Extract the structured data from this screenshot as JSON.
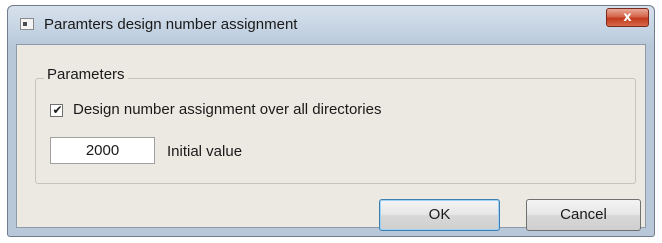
{
  "window": {
    "title": "Paramters design number assignment",
    "close_label": "x"
  },
  "parameters": {
    "group_label": "Parameters",
    "checkbox": {
      "label": "Design number assignment over all directories",
      "checked": true,
      "mark": "✔"
    },
    "initial_value": {
      "value": "2000",
      "label": "Initial value"
    }
  },
  "buttons": {
    "ok_label": "OK",
    "cancel_label": "Cancel"
  }
}
